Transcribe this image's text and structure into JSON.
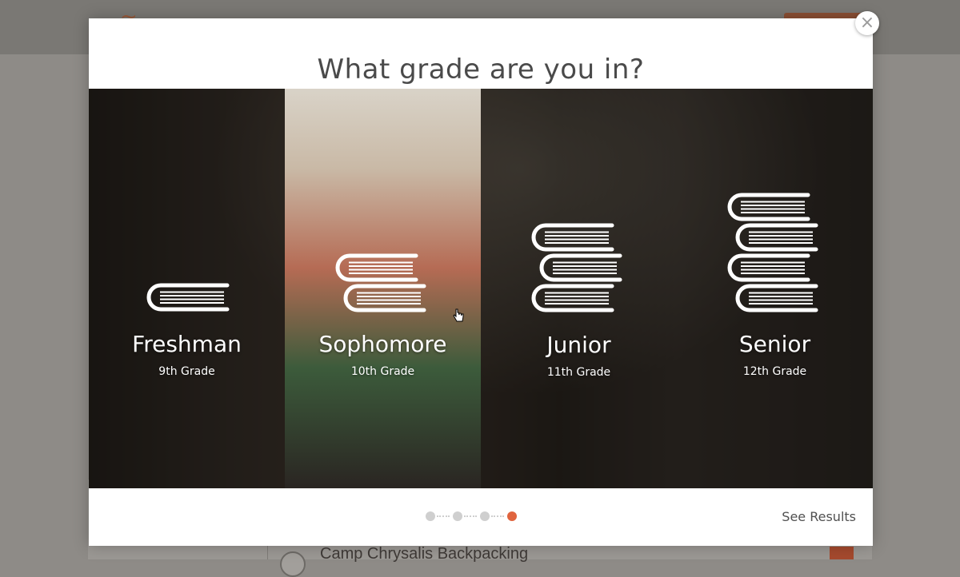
{
  "modal": {
    "title": "What grade are you in?",
    "close_label": "×",
    "footer": {
      "see_results": "See Results",
      "steps_total": 4,
      "active_step": 4
    }
  },
  "grades": [
    {
      "name": "Freshman",
      "sub": "9th Grade",
      "books": 1
    },
    {
      "name": "Sophomore",
      "sub": "10th Grade",
      "books": 2
    },
    {
      "name": "Junior",
      "sub": "11th Grade",
      "books": 3
    },
    {
      "name": "Senior",
      "sub": "12th Grade",
      "books": 4
    }
  ],
  "background_page": {
    "list_item_title": "Camp Chrysalis Backpacking",
    "sidebar_text": "..."
  },
  "colors": {
    "accent": "#e0643e",
    "dot_inactive": "#cfcfcf",
    "title_text": "#4a4a4a"
  },
  "icons": {
    "close": "close-icon",
    "grade": "book-stack-icon",
    "cursor": "hand-pointer-icon"
  }
}
